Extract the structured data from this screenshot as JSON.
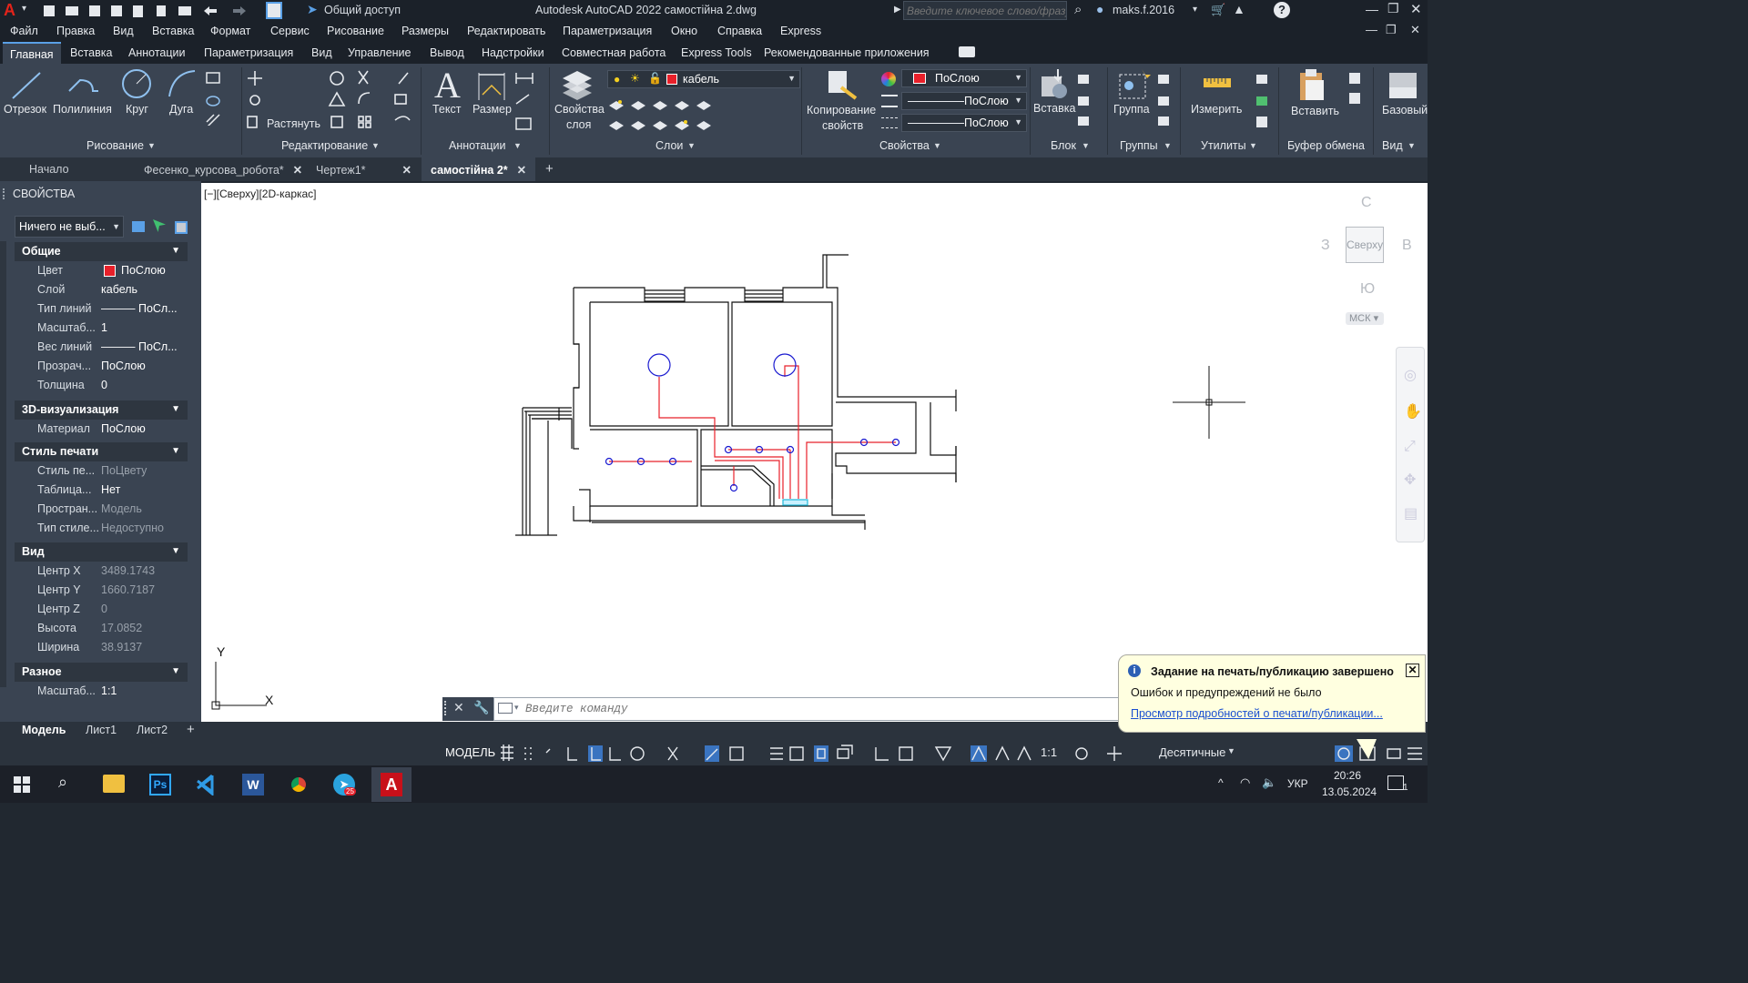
{
  "window": {
    "title": "Autodesk AutoCAD 2022   самостійна 2.dwg",
    "share_label": "Общий доступ",
    "search_placeholder": "Введите ключевое слово/фразу",
    "user": "maks.f.2016"
  },
  "menu": [
    "Файл",
    "Правка",
    "Вид",
    "Вставка",
    "Формат",
    "Сервис",
    "Рисование",
    "Размеры",
    "Редактировать",
    "Параметризация",
    "Окно",
    "Справка",
    "Express"
  ],
  "ribbon_tabs": [
    "Главная",
    "Вставка",
    "Аннотации",
    "Параметризация",
    "Вид",
    "Управление",
    "Вывод",
    "Надстройки",
    "Совместная работа",
    "Express Tools",
    "Рекомендованные приложения"
  ],
  "ribbon": {
    "draw": {
      "line": "Отрезок",
      "polyline": "Полилиния",
      "circle": "Круг",
      "arc": "Дуга",
      "panel": "Рисование"
    },
    "modify": {
      "stretch": "Растянуть",
      "panel": "Редактирование"
    },
    "annotation": {
      "text": "Текст",
      "dimension": "Размер",
      "panel": "Аннотации"
    },
    "layers": {
      "props_line1": "Свойства",
      "props_line2": "слоя",
      "current_layer": "кабель",
      "panel": "Слои"
    },
    "properties": {
      "match_line1": "Копирование",
      "match_line2": "свойств",
      "color": "ПоСлою",
      "linetype": "ПоСлою",
      "lineweight": "ПоСлою",
      "panel": "Свойства"
    },
    "block": {
      "insert": "Вставка",
      "panel": "Блок"
    },
    "groups": {
      "group": "Группа",
      "panel": "Группы"
    },
    "utilities": {
      "measure": "Измерить",
      "panel": "Утилиты"
    },
    "clipboard": {
      "paste": "Вставить",
      "panel": "Буфер обмена"
    },
    "view": {
      "base": "Базовый",
      "panel": "Вид"
    }
  },
  "doc_tabs": [
    "Начало",
    "Фесенко_курсова_робота*",
    "Чертеж1*",
    "самостійна 2*"
  ],
  "properties": {
    "title": "СВОЙСТВА",
    "selection": "Ничего не выб...",
    "sections": {
      "general": "Общие",
      "viz3d": "3D-визуализация",
      "plotstyle": "Стиль печати",
      "view": "Вид",
      "misc": "Разное"
    },
    "general": [
      {
        "k": "Цвет",
        "v": "ПоСлою"
      },
      {
        "k": "Слой",
        "v": "кабель"
      },
      {
        "k": "Тип линий",
        "v": "——— ПоСл..."
      },
      {
        "k": "Масштаб...",
        "v": "1"
      },
      {
        "k": "Вес линий",
        "v": "——— ПоСл..."
      },
      {
        "k": "Прозрач...",
        "v": "ПоСлою"
      },
      {
        "k": "Толщина",
        "v": "0"
      }
    ],
    "viz3d": [
      {
        "k": "Материал",
        "v": "ПоСлою"
      }
    ],
    "plotstyle": [
      {
        "k": "Стиль пе...",
        "v": "ПоЦвету"
      },
      {
        "k": "Таблица...",
        "v": "Нет"
      },
      {
        "k": "Простран...",
        "v": "Модель"
      },
      {
        "k": "Тип стиле...",
        "v": "Недоступно"
      }
    ],
    "view": [
      {
        "k": "Центр X",
        "v": "3489.1743"
      },
      {
        "k": "Центр Y",
        "v": "1660.7187"
      },
      {
        "k": "Центр Z",
        "v": "0"
      },
      {
        "k": "Высота",
        "v": "17.0852"
      },
      {
        "k": "Ширина",
        "v": "38.9137"
      }
    ],
    "misc": [
      {
        "k": "Масштаб...",
        "v": "1:1"
      }
    ]
  },
  "viewport_label": "[−][Сверху][2D-каркас]",
  "viewcube": {
    "north": "С",
    "south": "Ю",
    "west": "З",
    "east": "В",
    "face": "Сверху",
    "ucs": "МСК"
  },
  "ucs": {
    "x": "X",
    "y": "Y"
  },
  "command_placeholder": "Введите команду",
  "layout_tabs": [
    "Модель",
    "Лист1",
    "Лист2"
  ],
  "status": {
    "model": "МОДЕЛЬ",
    "scale": "1:1",
    "units": "Десятичные"
  },
  "notification": {
    "title": "Задание на печать/публикацию завершено",
    "body": "Ошибок и предупреждений не было",
    "link": "Просмотр подробностей о печати/публикации..."
  },
  "taskbar": {
    "lang": "УКР",
    "time": "20:26",
    "date": "13.05.2024",
    "badge": "25",
    "notif": "1"
  },
  "colors": {
    "accent": "#5aa0e6",
    "cable": "#e8202a",
    "device": "#1a1ad0",
    "wall": "#111111"
  }
}
